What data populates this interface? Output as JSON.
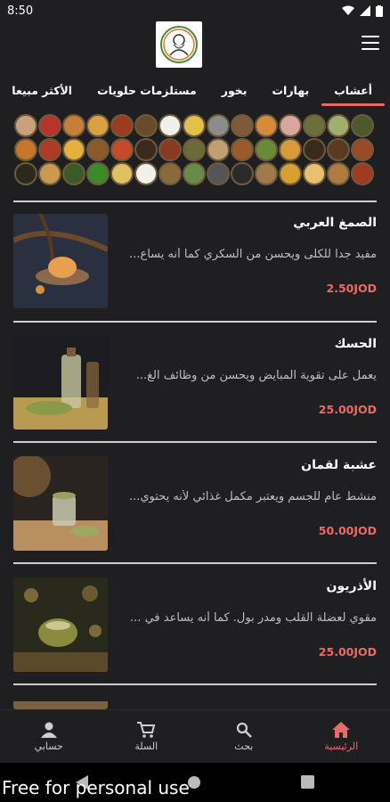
{
  "status": {
    "time": "8:50"
  },
  "app": {
    "logo": "logo-image"
  },
  "tabs": [
    {
      "label": "أعشاب",
      "active": true
    },
    {
      "label": "بهارات",
      "active": false
    },
    {
      "label": "بخور",
      "active": false
    },
    {
      "label": "مستلزمات حلويات",
      "active": false
    },
    {
      "label": "الأكثر مبيعا",
      "active": false
    }
  ],
  "spice_colors": [
    "#c9a27a",
    "#b8342a",
    "#c77e39",
    "#d9a240",
    "#9c3b22",
    "#6b4a2a",
    "#f0f0ea",
    "#e3c04a",
    "#8c8c8c",
    "#7b5b3a",
    "#d78a3a",
    "#d9a5a0",
    "#6a6f3b",
    "#a0b06a",
    "#4a5a2a",
    "#c8762a",
    "#b03a25",
    "#e6b040",
    "#8a5a2a",
    "#c44a2a",
    "#3a2a1c",
    "#8a3a22",
    "#6a6a3a",
    "#c0a070",
    "#9a5a2a",
    "#6a8a3a",
    "#d89a3a",
    "#3a2a1a",
    "#5a3a22",
    "#9a4a2a",
    "#2a2a1a",
    "#c99a50",
    "#3a5a2a",
    "#3a8a2a",
    "#e0c060",
    "#f2f0e8",
    "#8a6a3a",
    "#6a8a4a",
    "#555555",
    "#2a2a2a",
    "#a07a4a",
    "#d8a030",
    "#e8c070",
    "#b07a40",
    "#a03a22"
  ],
  "products": [
    {
      "name": "الصمغ العربي",
      "desc": "مفيد جدا للكلى ويحسن من السكري كما أنه يساع...",
      "price": "2.50JOD"
    },
    {
      "name": "الحسك",
      "desc": "يعمل على تقوية المبايض ويحسن من وظائف الغ...",
      "price": "25.00JOD"
    },
    {
      "name": "عشبة لقمان",
      "desc": "منشط عام للجسم ويعتبر مكمل غذائي لأنه يحتوي...",
      "price": "50.00JOD"
    },
    {
      "name": "الأذريون",
      "desc": "مقوي لعضلة القلب ومدر بول. كما أنه يساعد في ...",
      "price": "25.00JOD"
    }
  ],
  "bottom_nav": [
    {
      "label": "الرئيسية",
      "icon": "home-icon",
      "active": true
    },
    {
      "label": "بحث",
      "icon": "search-icon",
      "active": false
    },
    {
      "label": "السلة",
      "icon": "cart-icon",
      "active": false
    },
    {
      "label": "حسابي",
      "icon": "account-icon",
      "active": false
    }
  ],
  "colors": {
    "accent": "#e86a6a",
    "price": "#ec6a64",
    "background": "#1f1f22"
  },
  "watermark": "Free for personal use"
}
